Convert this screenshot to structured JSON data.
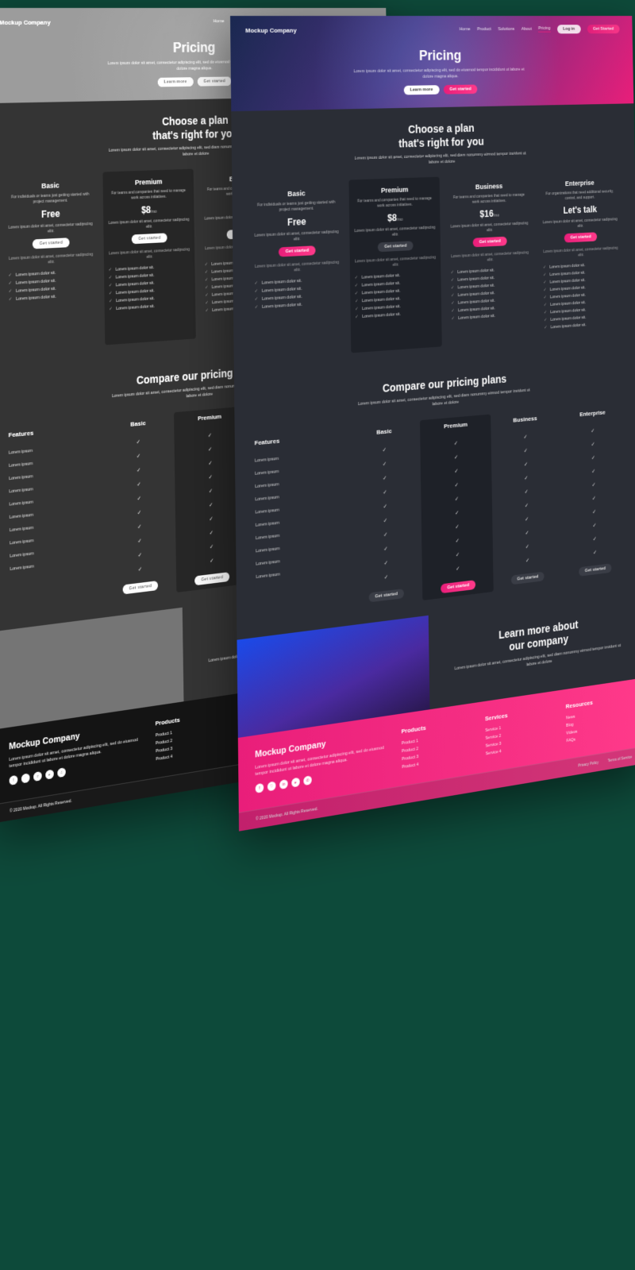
{
  "nav": {
    "logo": "Mockup Company",
    "links": [
      "Home",
      "Product",
      "Solutions",
      "About",
      "Pricing"
    ],
    "login": "Log in",
    "cta": "Get Started"
  },
  "hero": {
    "title": "Pricing",
    "sub": "Lorem ipsum dolor sit amet, consectetur adipiscing elit, sed do eiusmod tempor incididunt ut labore et dolore magna aliqua.",
    "btn1": "Learn more",
    "btn2": "Get started"
  },
  "plans": {
    "title1": "Choose a plan",
    "title2": "that's right for you",
    "sub": "Lorem ipsum dolor sit amet, consectetur adipiscing elit, sed diam nonummy eirmod tempor invidunt ut labore et dolore",
    "featIntro": "Lorem ipsum dolor sit amet, consectetur sadipscing elitr.",
    "feat": "Lorem ipsum dolor sit.",
    "cta": "Get started",
    "items": [
      {
        "name": "Basic",
        "desc": "For individuals or teams just getting started with project management.",
        "price": "Free",
        "per": "",
        "note": "Lorem ipsum dolor sit amet, consectetur sadipscing elitr.",
        "feats": 4,
        "hl": false
      },
      {
        "name": "Premium",
        "desc": "For teams and companies that need to manage work across initiatives.",
        "price": "$8",
        "per": "/mo",
        "note": "Lorem ipsum dolor sit amet, consectetur sadipscing elitr.",
        "feats": 6,
        "hl": true
      },
      {
        "name": "Business",
        "desc": "For teams and companies that need to manage work across initiatives.",
        "price": "$16",
        "per": "/mo",
        "note": "Lorem ipsum dolor sit amet, consectetur sadipscing elitr.",
        "feats": 7,
        "hl": false
      },
      {
        "name": "Enterprise",
        "desc": "For organizations that need additional security, control, and support.",
        "price": "Let's talk",
        "per": "",
        "note": "Lorem ipsum dolor sit amet, consectetur sadipscing elitr.",
        "feats": 9,
        "hl": false
      }
    ]
  },
  "compare": {
    "title": "Compare our pricing plans",
    "sub": "Lorem ipsum dolor sit amet, consectetur adipiscing elit, sed diam nonummy eirmod tempor invidunt ut labore et dolore",
    "featcol": "Features",
    "row": "Lorem ipsum",
    "cols": [
      "Basic",
      "Premium",
      "Business",
      "Enterprise"
    ],
    "rows": 10,
    "cta": "Get started"
  },
  "learn": {
    "title1": "Learn more about",
    "title2": "our company",
    "sub": "Lorem ipsum dolor sit amet, consectetur adipiscing elit, sed diam nonummy eirmod tempor invidunt ut labore et dolore"
  },
  "footer": {
    "logo": "Mockup Company",
    "desc": "Lorem ipsum dolor sit amet, consectetur adipiscing elit, sed do eiusmod tempor incididunt ut labore et dolore magna aliqua.",
    "cols": [
      {
        "h": "Products",
        "links": [
          "Product 1",
          "Product 2",
          "Product 3",
          "Product 4"
        ]
      },
      {
        "h": "Services",
        "links": [
          "Service 1",
          "Service 2",
          "Service 3",
          "Service 4"
        ]
      },
      {
        "h": "Resources",
        "links": [
          "News",
          "Blog",
          "Videos",
          "FAQs"
        ]
      }
    ],
    "copy": "© 2020 Mockup.  All Rights Reserved.",
    "legal": [
      "Privacy Policy",
      "Terms of Service"
    ]
  }
}
